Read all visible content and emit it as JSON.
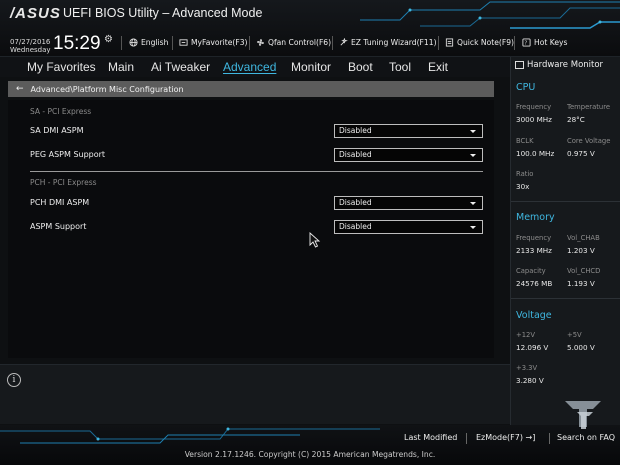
{
  "header": {
    "logo": "/ASUS",
    "title": "UEFI BIOS Utility – Advanced Mode",
    "date": "07/27/2016",
    "day": "Wednesday",
    "time": "15:29",
    "tools": [
      {
        "icon": "globe-icon",
        "label": "English"
      },
      {
        "icon": "myfavorite-icon",
        "label": "MyFavorite(F3)"
      },
      {
        "icon": "fan-icon",
        "label": "Qfan Control(F6)"
      },
      {
        "icon": "ez-tuning-icon",
        "label": "EZ Tuning Wizard(F11)"
      },
      {
        "icon": "note-icon",
        "label": "Quick Note(F9)"
      },
      {
        "icon": "hotkeys-icon",
        "label": "Hot Keys"
      }
    ]
  },
  "tabs": [
    {
      "label": "My Favorites",
      "active": false
    },
    {
      "label": "Main",
      "active": false
    },
    {
      "label": "Ai Tweaker",
      "active": false
    },
    {
      "label": "Advanced",
      "active": true
    },
    {
      "label": "Monitor",
      "active": false
    },
    {
      "label": "Boot",
      "active": false
    },
    {
      "label": "Tool",
      "active": false
    },
    {
      "label": "Exit",
      "active": false
    }
  ],
  "breadcrumb": "Advanced\\Platform Misc Configuration",
  "sections": [
    {
      "title": "SA - PCI Express",
      "options": [
        {
          "label": "SA DMI ASPM",
          "value": "Disabled"
        },
        {
          "label": "PEG ASPM Support",
          "value": "Disabled"
        }
      ]
    },
    {
      "title": "PCH - PCI Express",
      "options": [
        {
          "label": "PCH DMI ASPM",
          "value": "Disabled"
        },
        {
          "label": "ASPM Support",
          "value": "Disabled"
        }
      ]
    }
  ],
  "hardware_monitor": {
    "title": "Hardware Monitor",
    "cpu": {
      "heading": "CPU",
      "frequency_label": "Frequency",
      "frequency": "3000 MHz",
      "temperature_label": "Temperature",
      "temperature": "28°C",
      "bclk_label": "BCLK",
      "bclk": "100.0 MHz",
      "core_voltage_label": "Core Voltage",
      "core_voltage": "0.975 V",
      "ratio_label": "Ratio",
      "ratio": "30x"
    },
    "memory": {
      "heading": "Memory",
      "frequency_label": "Frequency",
      "frequency": "2133 MHz",
      "vol_chab_label": "Vol_CHAB",
      "vol_chab": "1.203 V",
      "capacity_label": "Capacity",
      "capacity": "24576 MB",
      "vol_chcd_label": "Vol_CHCD",
      "vol_chcd": "1.193 V"
    },
    "voltage": {
      "heading": "Voltage",
      "v12_label": "+12V",
      "v12": "12.096 V",
      "v5_label": "+5V",
      "v5": "5.000 V",
      "v33_label": "+3.3V",
      "v33": "3.280 V"
    }
  },
  "footer": {
    "last_modified": "Last Modified",
    "ezmode": "EzMode(F7)",
    "search": "Search on FAQ",
    "version": "Version 2.17.1246. Copyright (C) 2015 American Megatrends, Inc."
  },
  "colors": {
    "accent": "#3fb7e0",
    "breadcrumb_bg": "#5c5c5c",
    "panel_bg": "#16191c"
  }
}
